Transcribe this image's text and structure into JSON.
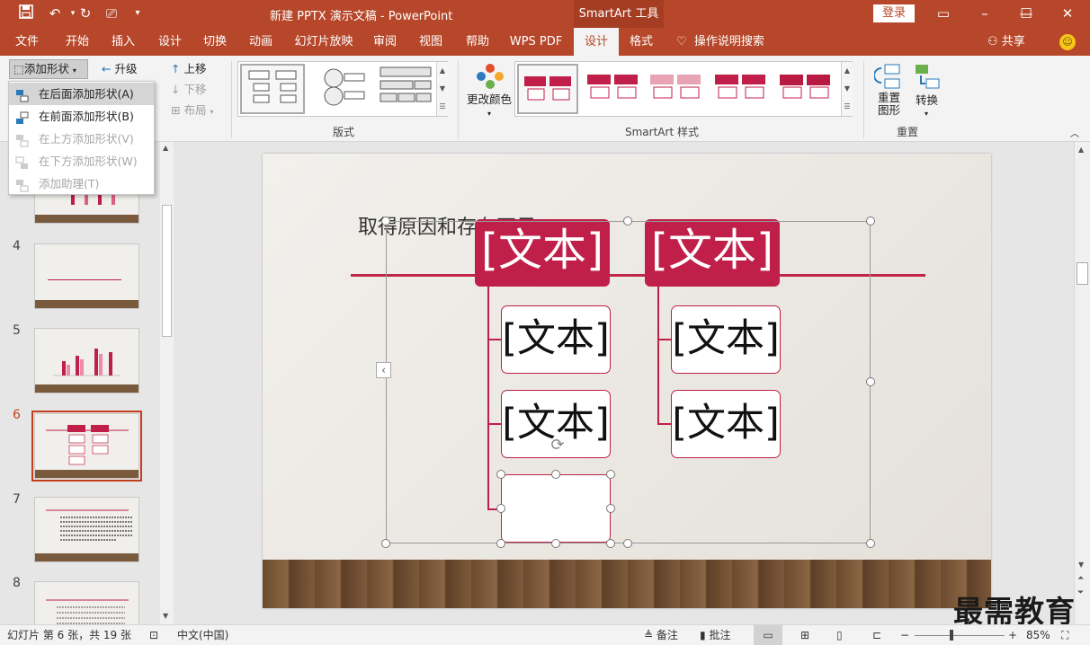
{
  "titlebar": {
    "doc_title": "新建 PPTX 演示文稿  -  PowerPoint",
    "context_tab": "SmartArt 工具",
    "login_label": "登录",
    "icons": [
      "save-icon",
      "undo-icon",
      "redo-icon",
      "present-icon",
      "customize-icon"
    ]
  },
  "menu": {
    "tabs": [
      "文件",
      "开始",
      "插入",
      "设计",
      "切换",
      "动画",
      "幻灯片放映",
      "审阅",
      "视图",
      "帮助",
      "WPS PDF",
      "设计",
      "格式"
    ],
    "active_index": 11,
    "tell_me": "操作说明搜索",
    "share": "共享"
  },
  "ribbon": {
    "add_shape": "添加形状",
    "promote": "升级",
    "move_up": "上移",
    "move_down": "下移",
    "layout_btn": "布局",
    "layouts_group": "版式",
    "change_colors": "更改颜色",
    "styles_group": "SmartArt 样式",
    "reset_graphic": "重置\n图形",
    "convert": "转换",
    "reset_group": "重置"
  },
  "dropdown": {
    "items": [
      {
        "label": "在后面添加形状(A)",
        "enabled": true,
        "highlight": true
      },
      {
        "label": "在前面添加形状(B)",
        "enabled": true,
        "highlight": false
      },
      {
        "label": "在上方添加形状(V)",
        "enabled": false,
        "highlight": false
      },
      {
        "label": "在下方添加形状(W)",
        "enabled": false,
        "highlight": false
      },
      {
        "label": "添加助理(T)",
        "enabled": false,
        "highlight": false
      }
    ]
  },
  "thumbnails": {
    "numbers": [
      "4",
      "5",
      "6",
      "7",
      "8"
    ],
    "selected": "6"
  },
  "slide": {
    "title": "取得原因和存在不足",
    "placeholder": "[文本]"
  },
  "status": {
    "slide_info": "幻灯片 第 6 张，共 19 张",
    "language": "中文(中国)",
    "notes": "备注",
    "comments": "批注",
    "zoom": "85%"
  },
  "watermark": "最需教育"
}
